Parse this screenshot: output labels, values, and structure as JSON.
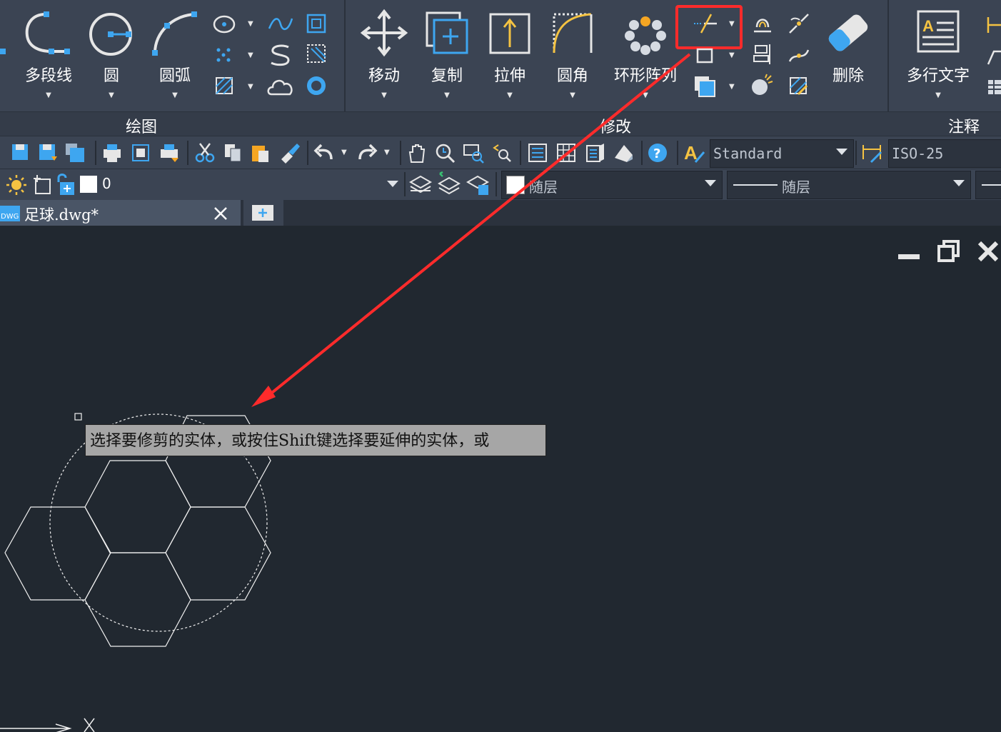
{
  "ribbon": {
    "draw_panel": {
      "title": "绘图",
      "buttons": [
        {
          "label": "多段线",
          "icon": "polyline-icon"
        },
        {
          "label": "圆",
          "icon": "circle-icon"
        },
        {
          "label": "圆弧",
          "icon": "arc-icon"
        }
      ]
    },
    "modify_panel": {
      "title": "修改",
      "buttons": [
        {
          "label": "移动",
          "icon": "move-icon"
        },
        {
          "label": "复制",
          "icon": "copy-icon"
        },
        {
          "label": "拉伸",
          "icon": "stretch-icon"
        },
        {
          "label": "圆角",
          "icon": "fillet-icon"
        },
        {
          "label": "环形阵列",
          "icon": "polar-array-icon"
        },
        {
          "label": "删除",
          "icon": "erase-icon"
        }
      ],
      "highlighted_tool": "trim-icon"
    },
    "annotate_panel": {
      "title": "注释",
      "buttons": [
        {
          "label": "多行文字",
          "icon": "mtext-icon"
        }
      ]
    }
  },
  "toolbar": {
    "text_style": "Standard",
    "dim_style": "ISO-25"
  },
  "layerbar": {
    "current_layer": "0",
    "color": "随层",
    "linetype": "随层"
  },
  "tabs": [
    {
      "label": "足球.dwg*",
      "active": true
    }
  ],
  "canvas": {
    "tooltip": "选择要修剪的实体，或按住Shift键选择要延伸的实体，或"
  },
  "colors": {
    "ribbon_bg": "#3b4453",
    "canvas_bg": "#212830",
    "accent_blue": "#3ea6f0",
    "highlight_red": "#ff2b2b"
  }
}
